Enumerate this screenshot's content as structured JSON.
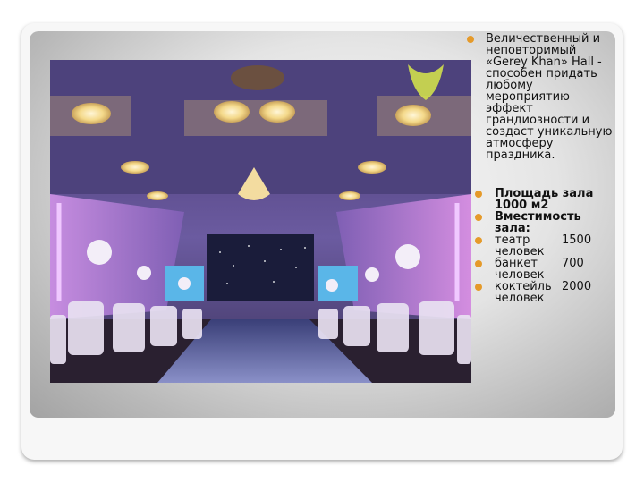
{
  "accent_color": "#e59a2a",
  "description": "Величественный и неповторимый «Gerey Khan» Hall - способен придать любому мероприятию эффект грандиозности и создаст уникальную атмосферу праздника.",
  "area": "Площадь зала 1000 м2",
  "capacity_heading": "Вместимость зала:",
  "capacity": [
    {
      "name": "театр",
      "value": "1500 человек"
    },
    {
      "name": "банкет",
      "value": "700 человек"
    },
    {
      "name": "коктейль",
      "value": "2000 человек"
    }
  ],
  "photo_icon": "banquet-hall-photo"
}
